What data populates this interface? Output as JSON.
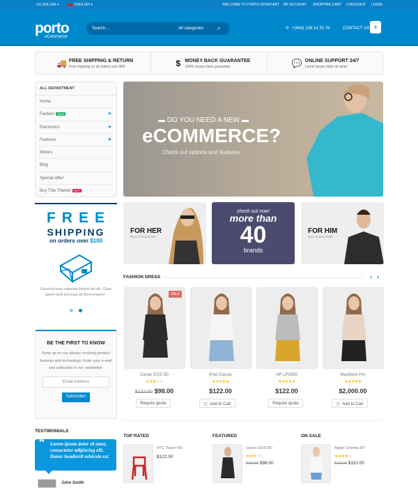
{
  "topbar": {
    "currency": "US DOLLAR ▾",
    "language": "ENGLISH ▾",
    "links": [
      "WELCOME TO PORTO OPENCART",
      "MY ACCOUNT",
      "SHOPPING CART",
      "CHECKOUT",
      "LOGIN"
    ]
  },
  "header": {
    "logo": "porto",
    "logo_sub": "eCommerce",
    "search_placeholder": "Search...",
    "category": "All categories",
    "phone": "+(404) 158 14 25 78",
    "contact": "CONTACT US",
    "cart_count": "0"
  },
  "features": [
    {
      "icon": "truck-icon",
      "title": "FREE SHIPPING & RETURN",
      "text": "Free shipping on all orders over $99."
    },
    {
      "icon": "dollar-icon",
      "title": "MONEY BACK GUARANTEE",
      "text": "100% money back guarantee."
    },
    {
      "icon": "chat-icon",
      "title": "ONLINE SUPPORT 24/7",
      "text": "Lorem ipsum dolor sit amet."
    }
  ],
  "menu": {
    "title": "ALL DEPARTMENT",
    "items": [
      {
        "label": "Home"
      },
      {
        "label": "Fashion",
        "badge": "NEW",
        "arrow": true
      },
      {
        "label": "Electronics",
        "arrow": true
      },
      {
        "label": "Features",
        "arrow": true
      },
      {
        "label": "Motors"
      },
      {
        "label": "Blog"
      },
      {
        "label": "Special offer!"
      },
      {
        "label": "Buy This Theme!",
        "badge": "HOT"
      }
    ]
  },
  "hero": {
    "pre": "DO YOU NEED A NEW",
    "title": "eCOMMERCE?",
    "sub": "Check out options and features."
  },
  "banners": {
    "her_title": "FOR HER",
    "her_sub": "Best Selling Deals",
    "mid_pre": "check out now!",
    "mid_title": "more than",
    "mid_num": "40",
    "mid_sub": "brands",
    "him_title": "FOR HIM",
    "him_sub": "Best Selling Deals"
  },
  "freeship": {
    "l1": "FREE",
    "l2": "SHIPPING",
    "l3": "on orders over",
    "l3b": "$100",
    "text": "Euismod atras vulputate iltricies etri elit. Class aptent taciti sociosqu ad litora torquent ."
  },
  "newsletter": {
    "title": "BE THE FIRST TO KNOW",
    "text": "Keep up on our always evolving product features and technology. Enter your e-mail and subscribe to our newsletter.",
    "placeholder": "Email Address",
    "button": "Subscribe!"
  },
  "fashion": {
    "title": "FASHION DRESS",
    "products": [
      {
        "name": "Canon EOS 5D",
        "rating": 3,
        "old": "$122.00",
        "price": "$98.00",
        "button": "Require quote",
        "sale": "SALE"
      },
      {
        "name": "iPod Classic",
        "rating": 4.5,
        "price": "$122.00",
        "button": "Add to Cart"
      },
      {
        "name": "HP LP3065",
        "rating": 5,
        "price": "$122.00",
        "button": "Require quote"
      },
      {
        "name": "MacBook Pro",
        "rating": 5,
        "price": "$2,000.00",
        "button": "Add to Cart"
      }
    ]
  },
  "testimonials": {
    "title": "TESTIMONIALS",
    "quote": "Lorem ipsum dolor sit amet, consectetur adipiscing elit. Donec hendrerit vehicula est.",
    "author": "John Smith"
  },
  "lists": [
    {
      "title": "TOP RATED",
      "name": "HTC Touch HD",
      "price": "$122.00"
    },
    {
      "title": "FEATURED",
      "name": "Canon EOS 5D",
      "rating": 3,
      "old": "$122.00",
      "price": "$98.00"
    },
    {
      "title": "ON SALE",
      "name": "Apple Cinema 30\"",
      "rating": 4,
      "old": "$122.00",
      "price": "$110.00"
    }
  ],
  "colors": {
    "primary": "#0088cc",
    "topbar": "#0a80c6",
    "purple": "#4c4a6e",
    "new": "#1ab26b",
    "hot": "#e8185e"
  }
}
